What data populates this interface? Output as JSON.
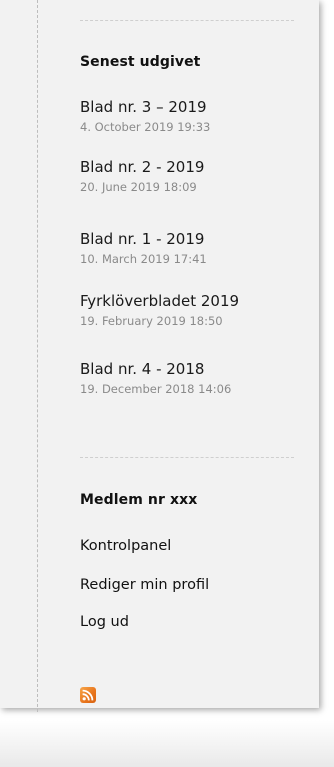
{
  "latest": {
    "title": "Senest udgivet",
    "posts": [
      {
        "title": "Blad nr. 3 – 2019",
        "date": "4. October 2019 19:33"
      },
      {
        "title": "Blad nr. 2 - 2019",
        "date": "20. June 2019 18:09"
      },
      {
        "title": "Blad nr. 1 - 2019",
        "date": "10. March 2019 17:41"
      },
      {
        "title": "Fyrklöverbladet 2019",
        "date": "19. February 2019 18:50"
      },
      {
        "title": "Blad nr. 4 - 2018",
        "date": "19. December 2018 14:06"
      }
    ]
  },
  "member": {
    "title": "Medlem nr xxx",
    "links": [
      {
        "label": "Kontrolpanel"
      },
      {
        "label": "Rediger min profil"
      },
      {
        "label": "Log ud"
      }
    ]
  },
  "feed": {
    "icon": "rss-icon",
    "color": "#f08a24"
  }
}
